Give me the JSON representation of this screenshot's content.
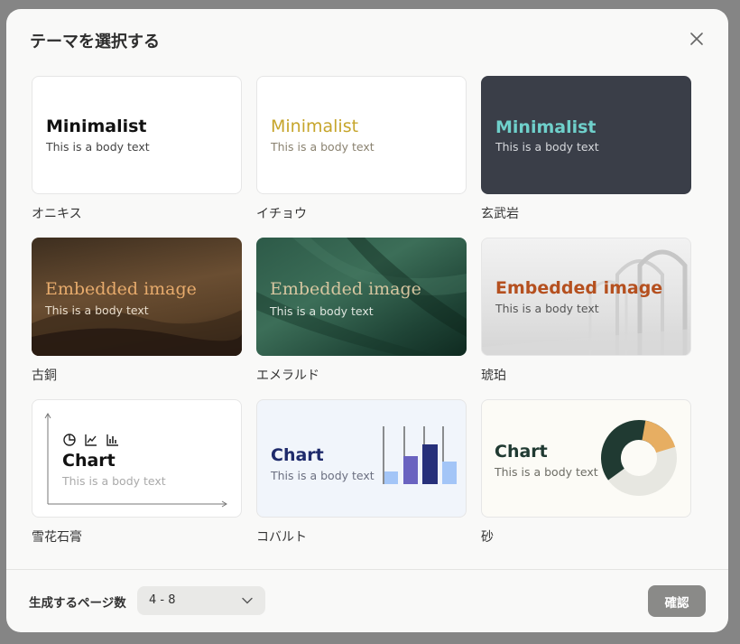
{
  "dialog": {
    "title": "テーマを選択する",
    "footer_label": "生成するページ数",
    "page_count_value": "4 - 8",
    "confirm_label": "確認"
  },
  "themes": [
    {
      "name": "オニキス",
      "heading": "Minimalist",
      "body": "This is a body text"
    },
    {
      "name": "イチョウ",
      "heading": "Minimalist",
      "body": "This is a body text"
    },
    {
      "name": "玄武岩",
      "heading": "Minimalist",
      "body": "This is a body text"
    },
    {
      "name": "古銅",
      "heading": "Embedded image",
      "body": "This is a body text"
    },
    {
      "name": "エメラルド",
      "heading": "Embedded image",
      "body": "This is a body text"
    },
    {
      "name": "琥珀",
      "heading": "Embedded image",
      "body": "This is a body text"
    },
    {
      "name": "雪花石膏",
      "heading": "Chart",
      "body": "This is a body text"
    },
    {
      "name": "コバルト",
      "heading": "Chart",
      "body": "This is a body text"
    },
    {
      "name": "砂",
      "heading": "Chart",
      "body": "This is a body text"
    }
  ],
  "colors": {
    "onyx_heading": "#111111",
    "ginkgo_heading": "#c6a52b",
    "basalt_bg": "#3a3e48",
    "basalt_heading": "#6fd0cb",
    "bronze_heading": "#e7ab6c",
    "emerald_heading": "#d6c6a0",
    "amber_heading": "#b5501f",
    "cobalt_heading": "#1e2a6b",
    "sand_heading": "#203a32"
  }
}
